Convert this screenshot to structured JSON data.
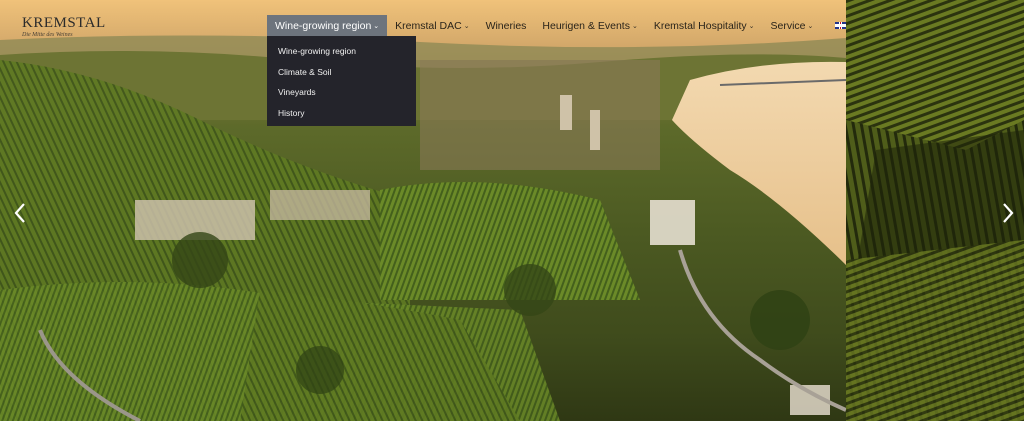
{
  "brand": {
    "name": "KREMSTAL",
    "tagline": "Die Mitte des Weines"
  },
  "nav": {
    "items": [
      {
        "label": "Wine-growing region",
        "has_dropdown": true,
        "active": true
      },
      {
        "label": "Kremstal DAC",
        "has_dropdown": true
      },
      {
        "label": "Wineries",
        "has_dropdown": false
      },
      {
        "label": "Heurigen & Events",
        "has_dropdown": true
      },
      {
        "label": "Kremstal Hospitality",
        "has_dropdown": true
      },
      {
        "label": "Service",
        "has_dropdown": true
      }
    ],
    "caret": "⌄",
    "language_flag": "uk-flag-icon"
  },
  "dropdown": {
    "items": [
      "Wine-growing region",
      "Climate & Soil",
      "Vineyards",
      "History"
    ]
  },
  "slider": {
    "prev_icon": "chevron-left-icon",
    "next_icon": "chevron-right-icon"
  },
  "colors": {
    "nav_active_bg": "#6d747d",
    "dropdown_bg": "#24242b",
    "dropdown_text": "#f1f1f1",
    "nav_text": "#2a241a"
  }
}
